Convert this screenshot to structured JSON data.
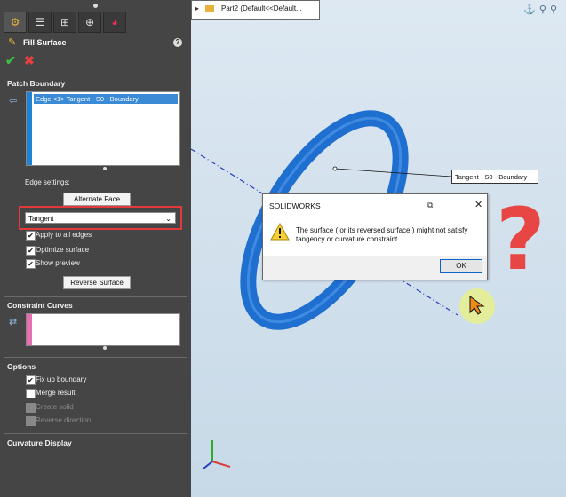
{
  "property_manager": {
    "title": "Fill Surface",
    "help_glyph": "?",
    "ok_glyph": "✔",
    "cancel_glyph": "✖",
    "patch_boundary": {
      "heading": "Patch Boundary",
      "items": [
        "Edge <1> Tangent - S0 - Boundary"
      ],
      "edge_settings_label": "Edge settings:",
      "alternate_face_button": "Alternate Face",
      "continuity_select": "Tangent",
      "apply_to_all_edges": "Apply to all edges",
      "optimize_surface": "Optimize surface",
      "show_preview": "Show preview",
      "reverse_surface_button": "Reverse Surface"
    },
    "constraint_curves": {
      "heading": "Constraint Curves"
    },
    "options": {
      "heading": "Options",
      "fix_up_boundary": "Fix up boundary",
      "merge_result": "Merge result",
      "create_solid": "Create solid",
      "reverse_direction": "Reverse direction"
    },
    "curvature_display": {
      "heading": "Curvature Display"
    }
  },
  "viewport": {
    "tree_label": "Part2  (Default<<Default...",
    "callout_text": "Tangent - S0 - Boundary",
    "question_mark": "?"
  },
  "dialog": {
    "title": "SOLIDWORKS",
    "message": "The surface ( or its reversed surface ) might not satisfy tangency or curvature constraint.",
    "ok_label": "OK"
  },
  "colors": {
    "panel_bg": "#454545",
    "surface_blue": "#1f6fd0",
    "highlight_red": "#e23a3a",
    "question_red": "#e84545"
  }
}
